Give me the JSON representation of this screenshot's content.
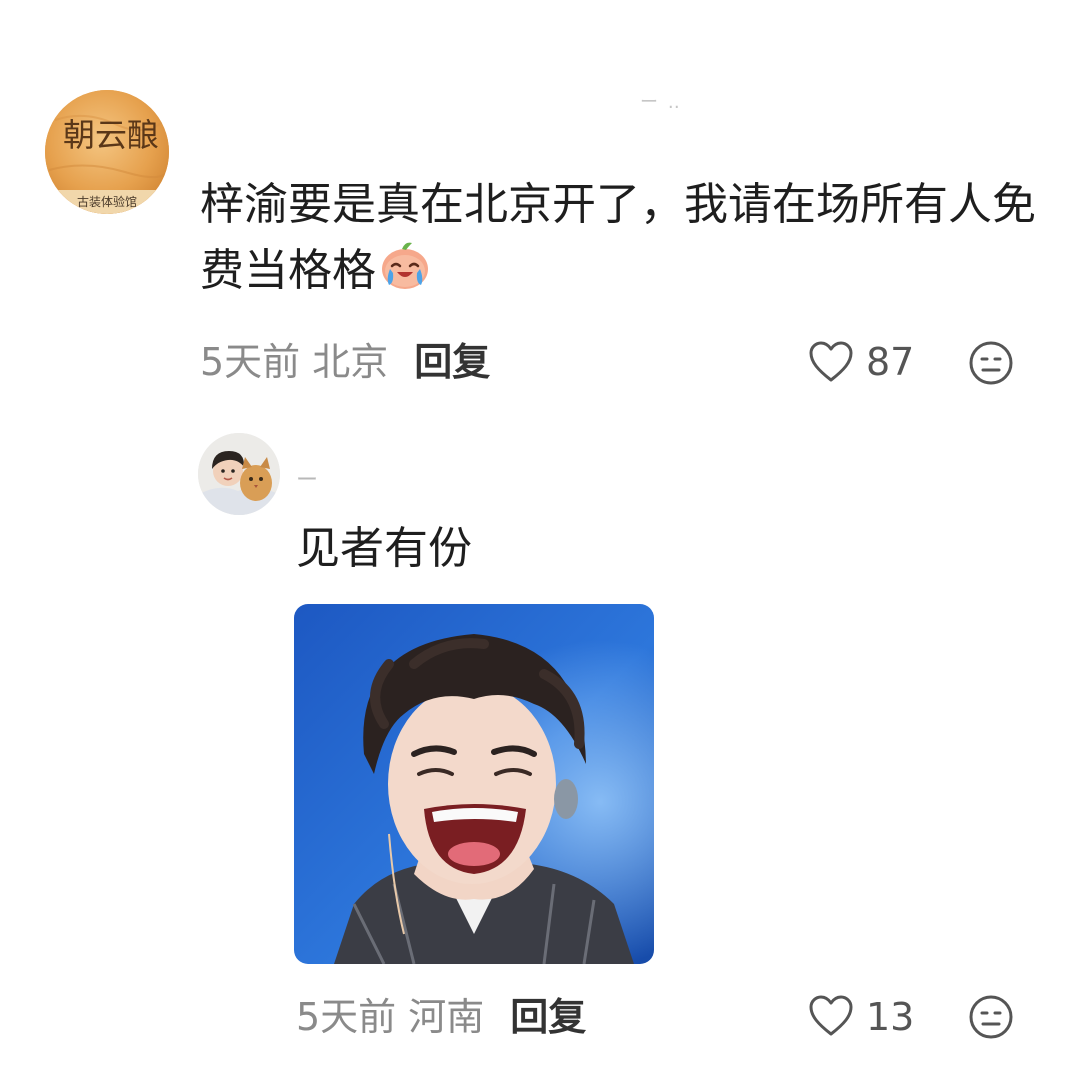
{
  "comments": [
    {
      "avatar_icon": "wine-club-logo-avatar",
      "avatar_text": "朝云酿",
      "avatar_subtext": "古装体验馆",
      "username": "ー ‥",
      "text": "梓渝要是真在北京开了，我请在场所有人免费当格格",
      "emoji": "crying-peach-emoji",
      "time": "5天前",
      "location": "北京",
      "reply_label": "回复",
      "like_count": "87",
      "like_icon": "heart-outline-icon",
      "dislike_icon": "neutral-face-icon"
    }
  ],
  "reply": {
    "avatar_icon": "boy-with-cat-avatar",
    "username": "ー",
    "text": "见者有份",
    "image": "laughing-singer-photo",
    "time": "5天前",
    "location": "河南",
    "reply_label": "回复",
    "like_count": "13",
    "like_icon": "heart-outline-icon",
    "dislike_icon": "neutral-face-icon"
  }
}
